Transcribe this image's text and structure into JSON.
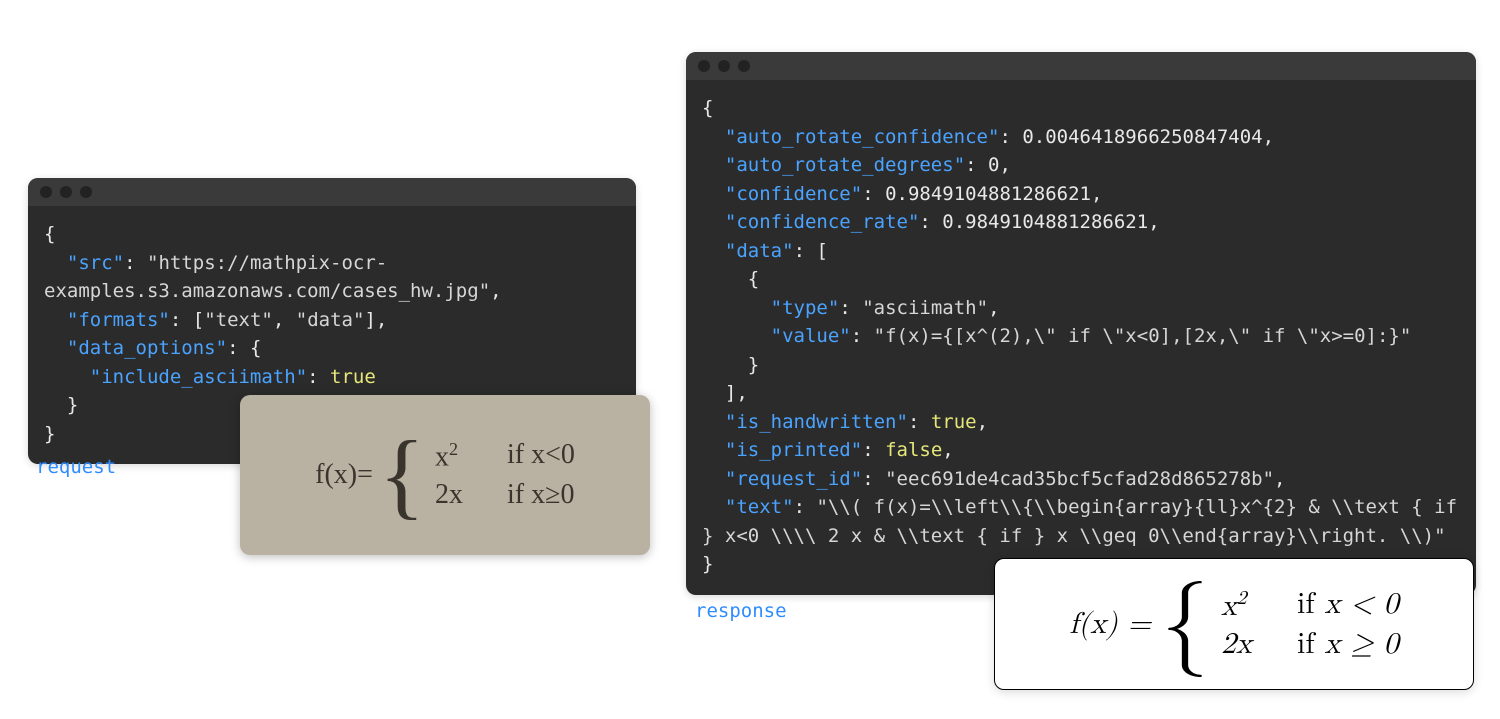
{
  "request": {
    "caption": "request",
    "json": {
      "src": "https://mathpix-ocr-examples.s3.amazonaws.com/cases_hw.jpg",
      "formats": [
        "text",
        "data"
      ],
      "data_options": {
        "include_asciimath": true
      }
    },
    "keys": {
      "src": "src",
      "formats": "formats",
      "data_options": "data_options",
      "include_asciimath": "include_asciimath"
    }
  },
  "response": {
    "caption": "response",
    "json": {
      "auto_rotate_confidence": 0.0046418966250847404,
      "auto_rotate_degrees": 0,
      "confidence": 0.9849104881286621,
      "confidence_rate": 0.9849104881286621,
      "data": [
        {
          "type": "asciimath",
          "value": "f(x)={[x^(2),\\\" if \\\"x<0],[2x,\\\" if \\\"x>=0]:}"
        }
      ],
      "is_handwritten": true,
      "is_printed": false,
      "request_id": "eec691de4cad35bcf5cfad28d865278b",
      "text": "\\\\( f(x)=\\\\left\\\\{\\\\begin{array}{ll}x^{2} & \\\\text { if } x<0 \\\\\\\\ 2 x & \\\\text { if } x \\\\geq 0\\\\end{array}\\\\right. \\\\)"
    },
    "keys": {
      "auto_rotate_confidence": "auto_rotate_confidence",
      "auto_rotate_degrees": "auto_rotate_degrees",
      "confidence": "confidence",
      "confidence_rate": "confidence_rate",
      "data": "data",
      "type": "type",
      "value": "value",
      "is_handwritten": "is_handwritten",
      "is_printed": "is_printed",
      "request_id": "request_id",
      "text": "text"
    }
  },
  "handwritten": {
    "lhs": "f(x)=",
    "row1_expr": "x",
    "row1_sup": "2",
    "row1_cond": "if x<0",
    "row2_expr": "2x",
    "row2_cond": "if x≥0"
  },
  "rendered": {
    "lhs_f": "f",
    "lhs_paren": "(x) = ",
    "row1_expr": "x",
    "row1_sup": "2",
    "row1_if": "if ",
    "row1_cond": "x < 0",
    "row2_expr": "2x",
    "row2_if": "if ",
    "row2_cond": "x ≥ 0"
  }
}
